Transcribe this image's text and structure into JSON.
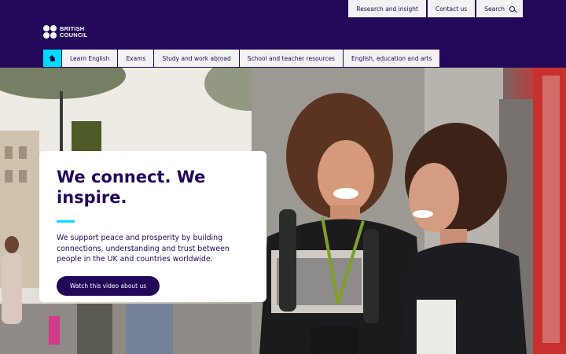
{
  "utility_nav": {
    "items": [
      "Research and insight",
      "Contact us",
      "Search"
    ]
  },
  "brand": {
    "line1": "BRITISH",
    "line2": "COUNCIL"
  },
  "main_nav": {
    "home_icon": "home-icon",
    "items": [
      "Learn English",
      "Exams",
      "Study and work abroad",
      "School and teacher resources",
      "English, education and arts"
    ]
  },
  "hero": {
    "heading": "We connect. We inspire.",
    "body": "We support peace and prosperity by building connections, understanding and trust between people in the UK and countries worldwide.",
    "cta": "Watch this video about us"
  },
  "colors": {
    "brand_purple": "#23085a",
    "accent_cyan": "#00dcff",
    "nav_bg": "#f2f2f2"
  }
}
